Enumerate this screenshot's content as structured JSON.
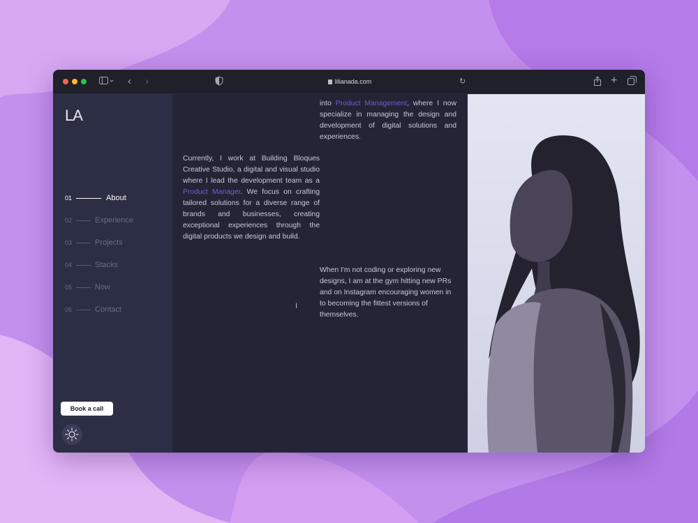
{
  "browser": {
    "url": "lilianada.com",
    "colors": {
      "titlebar": "#1f2029",
      "background": "#c490ee"
    }
  },
  "sidebar": {
    "logo": "LA",
    "nav": [
      {
        "num": "01",
        "label": "About",
        "active": true
      },
      {
        "num": "02",
        "label": "Experience",
        "active": false
      },
      {
        "num": "03",
        "label": "Projects",
        "active": false
      },
      {
        "num": "04",
        "label": "Stacks",
        "active": false
      },
      {
        "num": "05",
        "label": "Now",
        "active": false
      },
      {
        "num": "06",
        "label": "Contact",
        "active": false
      }
    ],
    "book_call_label": "Book a call",
    "theme_toggle_icon": "sun-icon"
  },
  "content": {
    "para0": {
      "before": "",
      "link": "Product Management",
      "after": ", where I now specialize in managing the design and development of digital solutions and experiences."
    },
    "para0_lead": "into ",
    "para1": {
      "before": "Currently, I work at Building Bloques Creative Studio, a digital and visual studio where I lead the development team as a ",
      "link": "Product Manager",
      "after": ". We focus on crafting tailored solutions for a diverse range of brands and businesses, creating exceptional experiences through the digital products we design and build."
    },
    "para2": "When I'm not coding or exploring new designs, I am at the gym hitting new PRs and on Instagram encouraging women in to becoming the fittest versions of themselves.",
    "accent": "#6a5fd9"
  },
  "photo": {
    "subject": "portrait-photo"
  }
}
